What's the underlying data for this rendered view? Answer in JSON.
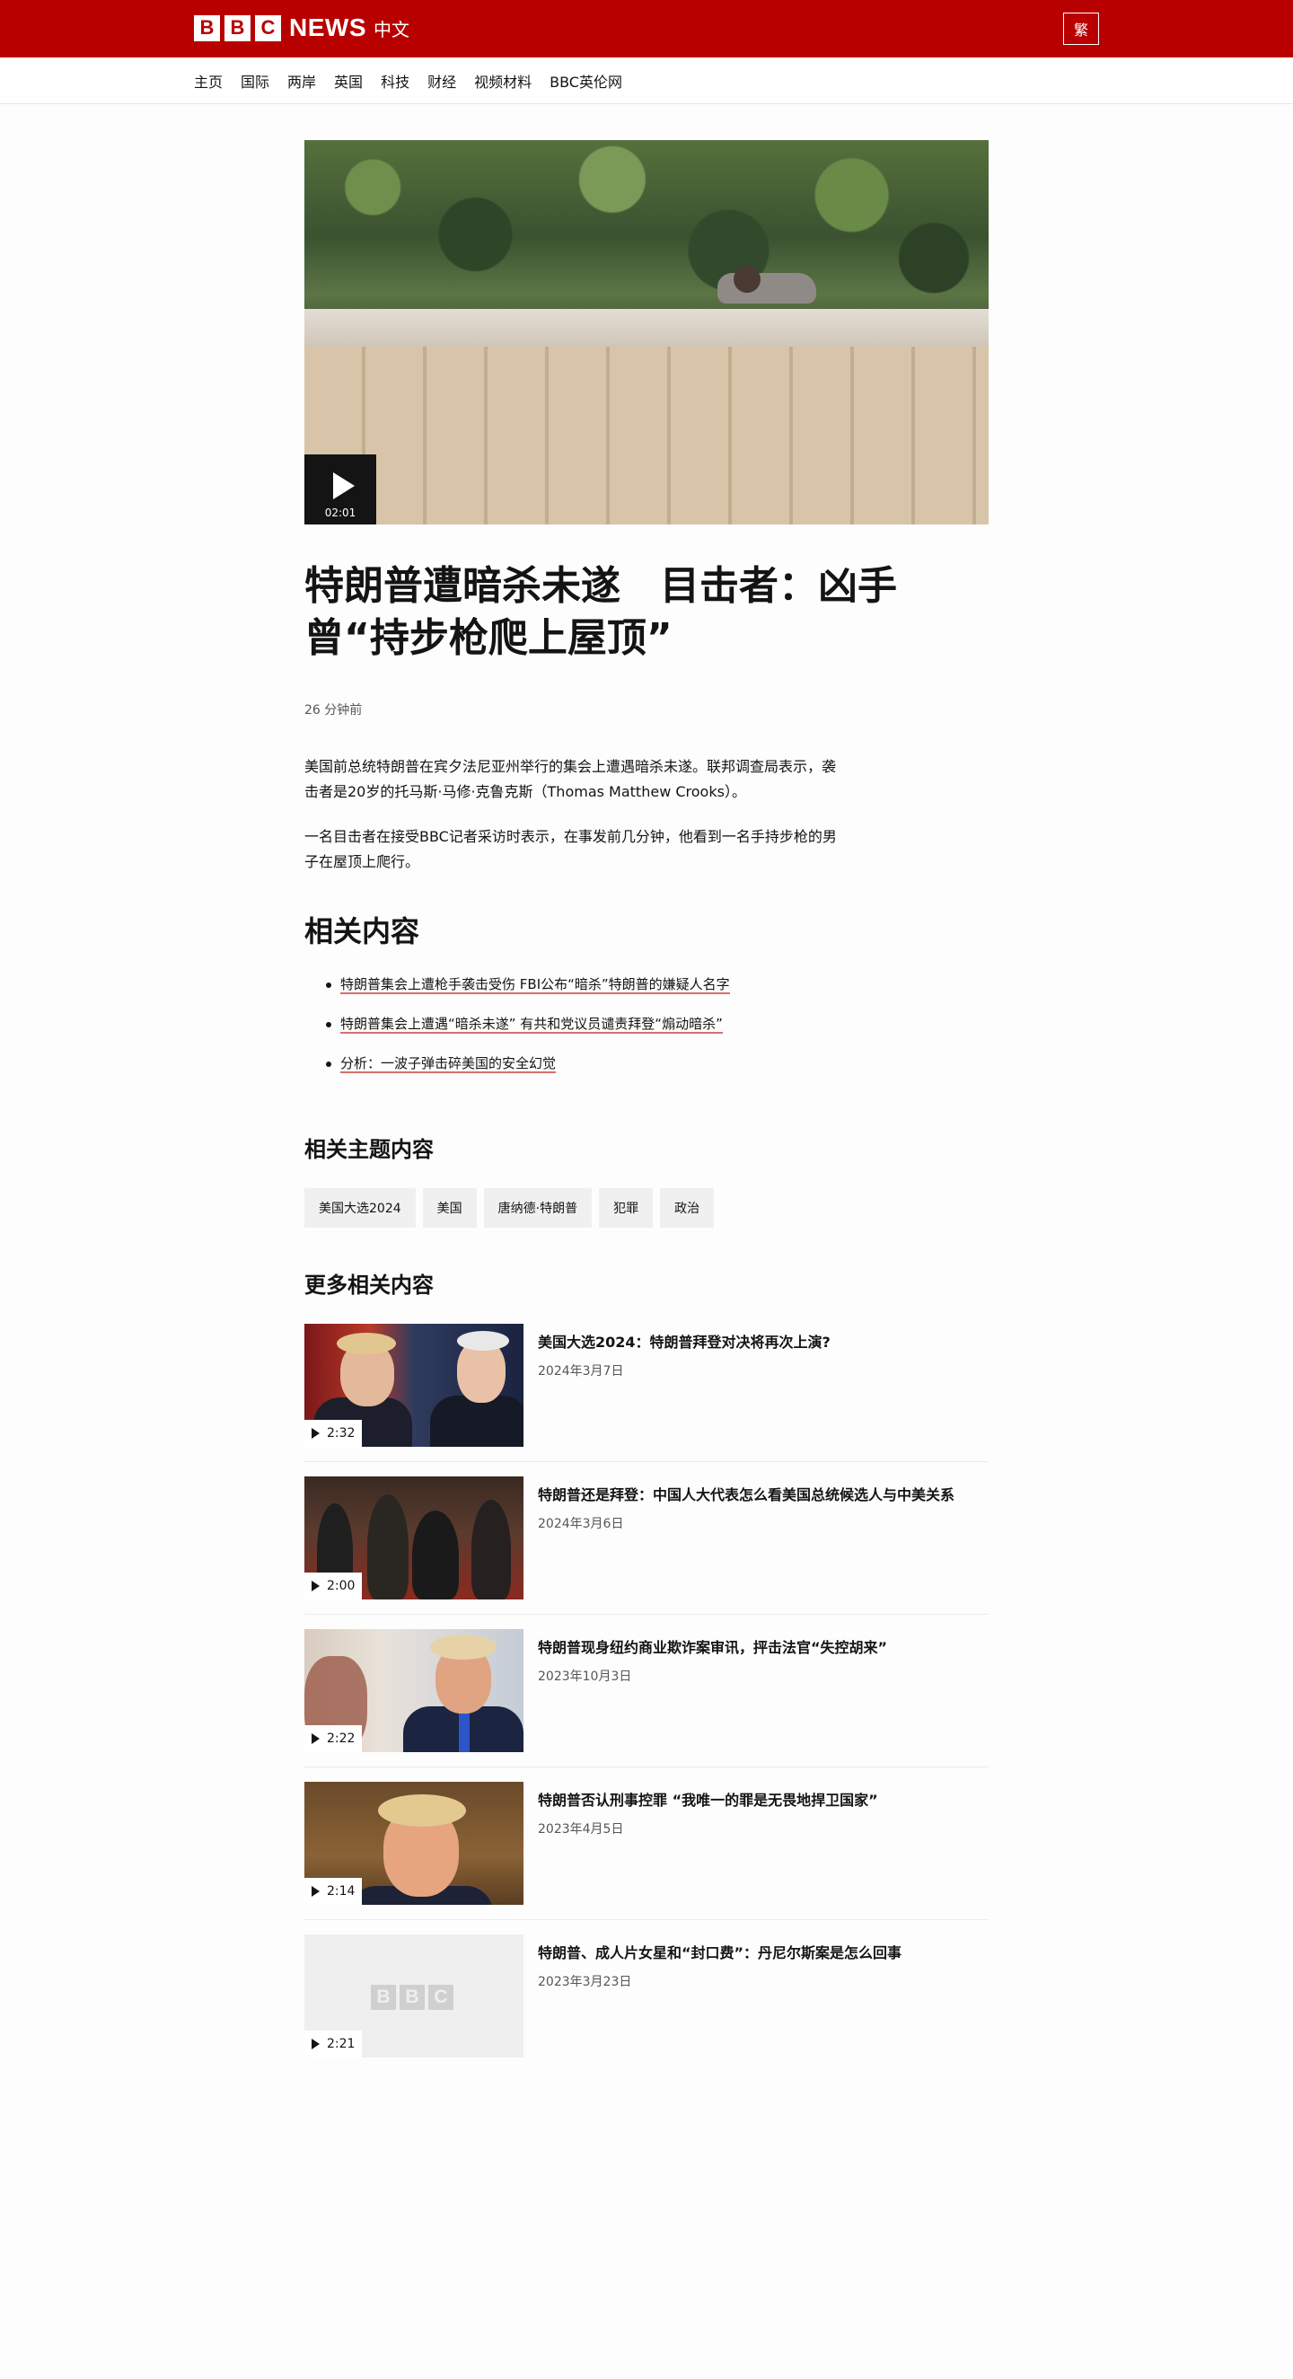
{
  "header": {
    "brand_letters": [
      "B",
      "B",
      "C"
    ],
    "brand_news": "NEWS",
    "brand_lang": "中文",
    "traditional_toggle": "繁",
    "brand_color": "#b80000"
  },
  "nav": {
    "items": [
      "主页",
      "国际",
      "两岸",
      "英国",
      "科技",
      "财经",
      "视频材料",
      "BBC英伦网"
    ]
  },
  "video": {
    "duration": "02:01",
    "icon": "play-icon"
  },
  "article": {
    "headline": "特朗普遭暗杀未遂　目击者：凶手曾“持步枪爬上屋顶”",
    "timestamp": "26 分钟前",
    "paragraphs": [
      "美国前总统特朗普在宾夕法尼亚州举行的集会上遭遇暗杀未遂。联邦调查局表示，袭击者是20岁的托马斯·马修·克鲁克斯（Thomas Matthew Crooks）。",
      "一名目击者在接受BBC记者采访时表示，在事发前几分钟，他看到一名手持步枪的男子在屋顶上爬行。"
    ]
  },
  "related": {
    "heading": "相关内容",
    "links": [
      "特朗普集会上遭枪手袭击受伤 FBI公布“暗杀”特朗普的嫌疑人名字",
      "特朗普集会上遭遇“暗杀未遂” 有共和党议员谴责拜登“煽动暗杀”",
      "分析：一波子弹击碎美国的安全幻觉"
    ]
  },
  "topics": {
    "heading": "相关主题内容",
    "items": [
      "美国大选2024",
      "美国",
      "唐纳德·特朗普",
      "犯罪",
      "政治"
    ]
  },
  "more": {
    "heading": "更多相关内容",
    "cards": [
      {
        "title": "美国大选2024：特朗普拜登对决将再次上演?",
        "date": "2024年3月7日",
        "duration": "2:32"
      },
      {
        "title": "特朗普还是拜登：中国人大代表怎么看美国总统候选人与中美关系",
        "date": "2024年3月6日",
        "duration": "2:00"
      },
      {
        "title": "特朗普现身纽约商业欺诈案审讯，抨击法官“失控胡来”",
        "date": "2023年10月3日",
        "duration": "2:22"
      },
      {
        "title": "特朗普否认刑事控罪 “我唯一的罪是无畏地捍卫国家”",
        "date": "2023年4月5日",
        "duration": "2:14"
      },
      {
        "title": "特朗普、成人片女星和“封口费”：丹尼尔斯案是怎么回事",
        "date": "2023年3月23日",
        "duration": "2:21",
        "placeholder_letters": [
          "B",
          "B",
          "C"
        ]
      }
    ]
  }
}
